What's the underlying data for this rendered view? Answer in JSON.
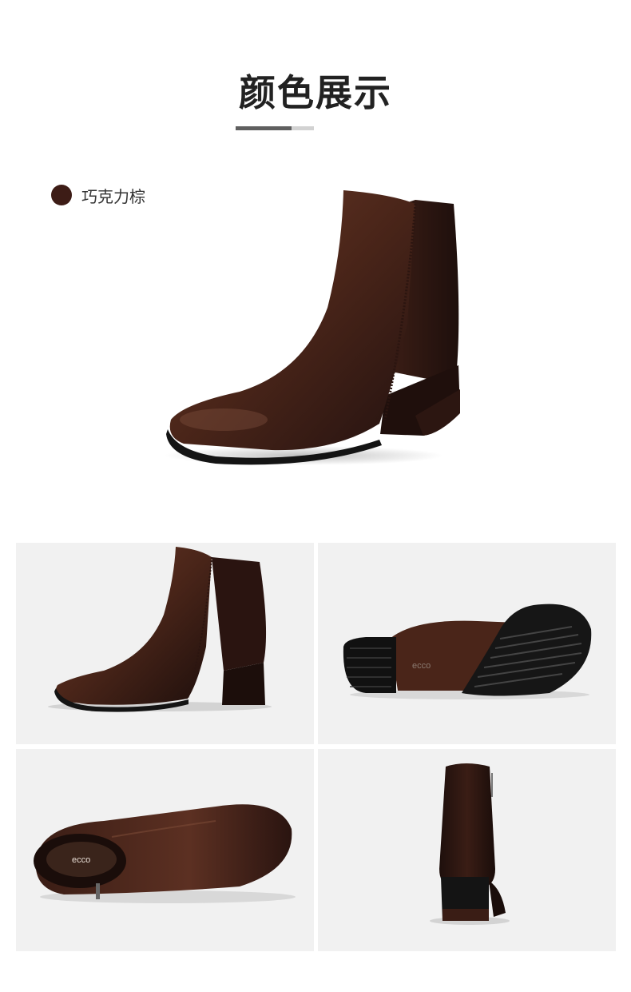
{
  "header": {
    "title": "颜色展示"
  },
  "color_option": {
    "label": "巧克力棕",
    "swatch_color": "#3d1c16"
  },
  "colors": {
    "leather_dark": "#2a1410",
    "leather_mid": "#4a2519",
    "leather_light": "#7a4a36",
    "sole": "#1a1a1a",
    "panel_bg": "#f1f1f1"
  },
  "sole_logo": "ecco",
  "insole_logo": "ecco"
}
